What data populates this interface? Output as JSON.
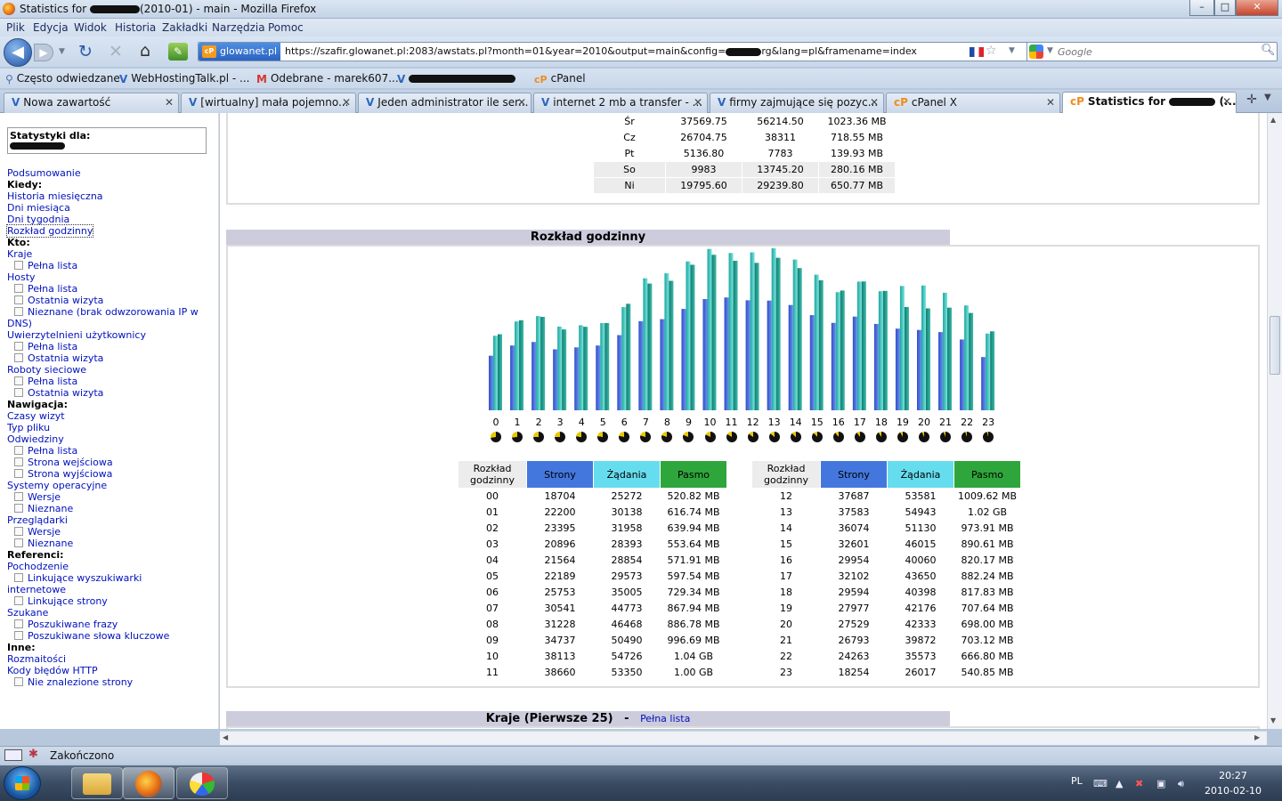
{
  "window": {
    "title_prefix": "Statistics for",
    "title_suffix": "(2010-01) - main - Mozilla Firefox",
    "btn_min": "–",
    "btn_max": "□",
    "btn_close": "✕"
  },
  "menu": [
    "Plik",
    "Edycja",
    "Widok",
    "Historia",
    "Zakładki",
    "Narzędzia",
    "Pomoc"
  ],
  "navbar": {
    "site_label": "glowanet.pl",
    "url": "https://szafir.glowanet.pl:2083/awstats.pl?month=01&year=2010&output=main&config=",
    "url_tail": "rg&lang=pl&framename=index",
    "search_placeholder": "Google"
  },
  "bookmarks": [
    "Często odwiedzane",
    "WebHostingTalk.pl - ...",
    "Odebrane - marek607...",
    "cPanel"
  ],
  "tabs": [
    {
      "label": "Nowa zawartość"
    },
    {
      "label": "[wirtualny] mała pojemno..."
    },
    {
      "label": "Jeden administrator ile ser..."
    },
    {
      "label": "internet 2 mb a transfer - ..."
    },
    {
      "label": "firmy zajmujące się pozyc..."
    },
    {
      "label": "cPanel X"
    },
    {
      "label": "Statistics for"
    },
    {
      "label": "(..."
    }
  ],
  "sidebar": {
    "stat_label": "Statystyki dla:",
    "items": [
      {
        "t": "link",
        "label": "Podsumowanie"
      },
      {
        "t": "head",
        "label": "Kiedy:"
      },
      {
        "t": "link",
        "label": "Historia miesięczna"
      },
      {
        "t": "link",
        "label": "Dni miesiąca"
      },
      {
        "t": "link",
        "label": "Dni tygodnia"
      },
      {
        "t": "focus",
        "label": "Rozkład godzinny"
      },
      {
        "t": "head",
        "label": "Kto:"
      },
      {
        "t": "link",
        "label": "Kraje"
      },
      {
        "t": "sub",
        "label": "Pełna lista"
      },
      {
        "t": "link",
        "label": "Hosty"
      },
      {
        "t": "sub",
        "label": "Pełna lista"
      },
      {
        "t": "sub",
        "label": "Ostatnia wizyta"
      },
      {
        "t": "sub",
        "label": "Nieznane (brak odwzorowania IP w"
      },
      {
        "t": "link",
        "label": "DNS)"
      },
      {
        "t": "link",
        "label": "Uwierzytelnieni użytkownicy"
      },
      {
        "t": "sub",
        "label": "Pełna lista"
      },
      {
        "t": "sub",
        "label": "Ostatnia wizyta"
      },
      {
        "t": "link",
        "label": "Roboty sieciowe"
      },
      {
        "t": "sub",
        "label": "Pełna lista"
      },
      {
        "t": "sub",
        "label": "Ostatnia wizyta"
      },
      {
        "t": "head",
        "label": "Nawigacja:"
      },
      {
        "t": "link",
        "label": "Czasy wizyt"
      },
      {
        "t": "link",
        "label": "Typ pliku"
      },
      {
        "t": "link",
        "label": "Odwiedziny"
      },
      {
        "t": "sub",
        "label": "Pełna lista"
      },
      {
        "t": "sub",
        "label": "Strona wejściowa"
      },
      {
        "t": "sub",
        "label": "Strona wyjściowa"
      },
      {
        "t": "link",
        "label": "Systemy operacyjne"
      },
      {
        "t": "sub",
        "label": "Wersje"
      },
      {
        "t": "sub",
        "label": "Nieznane"
      },
      {
        "t": "link",
        "label": "Przeglądarki"
      },
      {
        "t": "sub",
        "label": "Wersje"
      },
      {
        "t": "sub",
        "label": "Nieznane"
      },
      {
        "t": "head",
        "label": "Referenci:"
      },
      {
        "t": "link",
        "label": "Pochodzenie"
      },
      {
        "t": "sub",
        "label": "Linkujące wyszukiwarki"
      },
      {
        "t": "link",
        "label": "internetowe"
      },
      {
        "t": "sub",
        "label": "Linkujące strony"
      },
      {
        "t": "link",
        "label": "Szukane"
      },
      {
        "t": "sub",
        "label": "Poszukiwane frazy"
      },
      {
        "t": "sub",
        "label": "Poszukiwane słowa kluczowe"
      },
      {
        "t": "head",
        "label": "Inne:"
      },
      {
        "t": "link",
        "label": "Rozmaitości"
      },
      {
        "t": "link",
        "label": "Kody błędów HTTP"
      },
      {
        "t": "sub",
        "label": "Nie znalezione strony"
      }
    ]
  },
  "days_table": [
    [
      "Śr",
      "37569.75",
      "56214.50",
      "1023.36 MB"
    ],
    [
      "Cz",
      "26704.75",
      "38311",
      "718.55 MB"
    ],
    [
      "Pt",
      "5136.80",
      "7783",
      "139.93 MB"
    ],
    [
      "So",
      "9983",
      "13745.20",
      "280.16 MB"
    ],
    [
      "Ni",
      "19795.60",
      "29239.80",
      "650.77 MB"
    ]
  ],
  "hourly": {
    "title": "Rozkład godzinny",
    "col_hour": "Rozkład godzinny",
    "col_pages": "Strony",
    "col_hits": "Żądania",
    "col_bandwidth": "Pasmo",
    "rows": [
      [
        "00",
        "18704",
        "25272",
        "520.82 MB"
      ],
      [
        "01",
        "22200",
        "30138",
        "616.74 MB"
      ],
      [
        "02",
        "23395",
        "31958",
        "639.94 MB"
      ],
      [
        "03",
        "20896",
        "28393",
        "553.64 MB"
      ],
      [
        "04",
        "21564",
        "28854",
        "571.91 MB"
      ],
      [
        "05",
        "22189",
        "29573",
        "597.54 MB"
      ],
      [
        "06",
        "25753",
        "35005",
        "729.34 MB"
      ],
      [
        "07",
        "30541",
        "44773",
        "867.94 MB"
      ],
      [
        "08",
        "31228",
        "46468",
        "886.78 MB"
      ],
      [
        "09",
        "34737",
        "50490",
        "996.69 MB"
      ],
      [
        "10",
        "38113",
        "54726",
        "1.04 GB"
      ],
      [
        "11",
        "38660",
        "53350",
        "1.00 GB"
      ],
      [
        "12",
        "37687",
        "53581",
        "1009.62 MB"
      ],
      [
        "13",
        "37583",
        "54943",
        "1.02 GB"
      ],
      [
        "14",
        "36074",
        "51130",
        "973.91 MB"
      ],
      [
        "15",
        "32601",
        "46015",
        "890.61 MB"
      ],
      [
        "16",
        "29954",
        "40060",
        "820.17 MB"
      ],
      [
        "17",
        "32102",
        "43650",
        "882.24 MB"
      ],
      [
        "18",
        "29594",
        "40398",
        "817.83 MB"
      ],
      [
        "19",
        "27977",
        "42176",
        "707.64 MB"
      ],
      [
        "20",
        "27529",
        "42333",
        "698.00 MB"
      ],
      [
        "21",
        "26793",
        "39872",
        "703.12 MB"
      ],
      [
        "22",
        "24263",
        "35573",
        "666.80 MB"
      ],
      [
        "23",
        "18254",
        "26017",
        "540.85 MB"
      ]
    ],
    "bar_labels": [
      "0",
      "1",
      "2",
      "3",
      "4",
      "5",
      "6",
      "7",
      "8",
      "9",
      "10",
      "11",
      "12",
      "13",
      "14",
      "15",
      "16",
      "17",
      "18",
      "19",
      "20",
      "21",
      "22",
      "23"
    ],
    "pages": [
      18704,
      22200,
      23395,
      20896,
      21564,
      22189,
      25753,
      30541,
      31228,
      34737,
      38113,
      38660,
      37687,
      37583,
      36074,
      32601,
      29954,
      32102,
      29594,
      27977,
      27529,
      26793,
      24263,
      18254
    ],
    "hits": [
      25272,
      30138,
      31958,
      28393,
      28854,
      29573,
      35005,
      44773,
      46468,
      50490,
      54726,
      53350,
      53581,
      54943,
      51130,
      46015,
      40060,
      43650,
      40398,
      42176,
      42333,
      39872,
      35573,
      26017
    ],
    "bandwidth_mb": [
      520.82,
      616.74,
      639.94,
      553.64,
      571.91,
      597.54,
      729.34,
      867.94,
      886.78,
      996.69,
      1064.96,
      1024,
      1009.62,
      1044.48,
      973.91,
      890.61,
      820.17,
      882.24,
      817.83,
      707.64,
      698.0,
      703.12,
      666.8,
      540.85
    ],
    "colors": {
      "pages": "#4466dd",
      "hits": "#3fc6c0",
      "bandwidth": "#1f9a8c"
    }
  },
  "countries_section": {
    "title": "Kraje (Pierwsze 25)",
    "sep": "-",
    "link": "Pełna lista"
  },
  "status": {
    "text": "Zakończono"
  },
  "taskbar": {
    "lang": "PL",
    "time": "20:27",
    "date": "2010-02-10"
  }
}
